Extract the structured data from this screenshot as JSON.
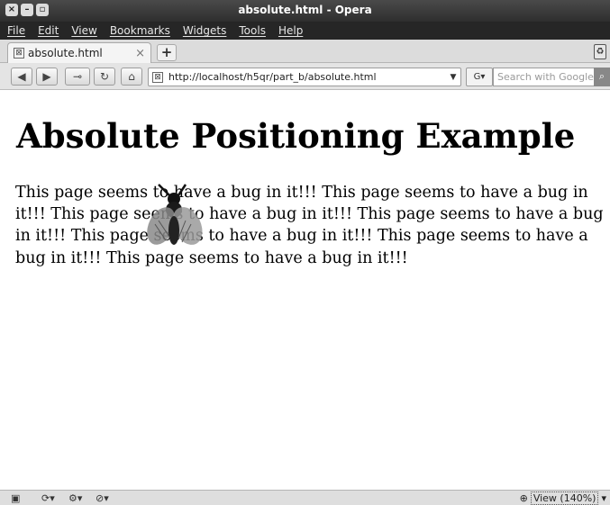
{
  "window": {
    "title": "absolute.html - Opera"
  },
  "menu": {
    "items": [
      "File",
      "Edit",
      "View",
      "Bookmarks",
      "Widgets",
      "Tools",
      "Help"
    ]
  },
  "tabs": {
    "active_label": "absolute.html"
  },
  "address": {
    "url": "http://localhost/h5qr/part_b/absolute.html",
    "search_placeholder": "Search with Google"
  },
  "page": {
    "heading": "Absolute Positioning Example",
    "paragraph": "This page seems to have a bug in it!!! This page seems to have a bug in it!!! This page seems to have a bug in it!!! This page seems to have a bug in it!!! This page seems to have a bug in it!!! This page seems to have a bug in it!!! This page seems to have a bug in it!!!"
  },
  "statusbar": {
    "zoom_label": "View (140%)"
  },
  "icons": {
    "close": "close-icon",
    "minimize": "minimize-icon",
    "maximize": "maximize-icon",
    "back": "back-icon",
    "forward": "forward-icon",
    "key": "key-icon",
    "reload": "reload-icon",
    "home": "home-icon",
    "bug": "bug-image"
  }
}
